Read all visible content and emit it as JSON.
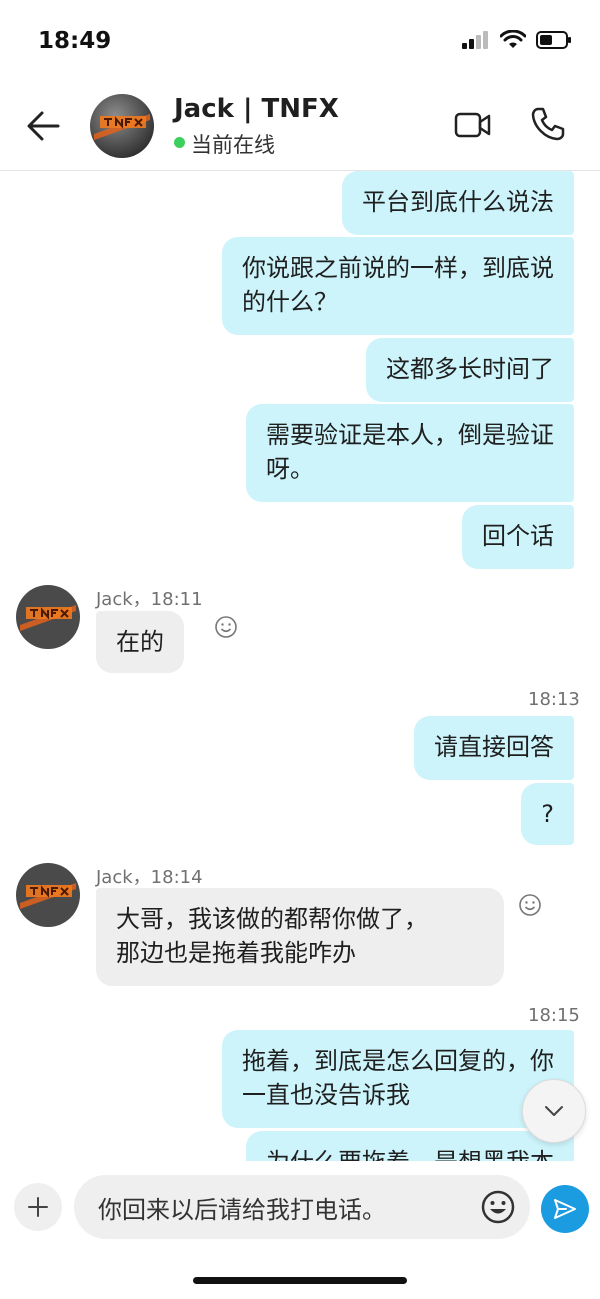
{
  "status_bar": {
    "time": "18:49"
  },
  "header": {
    "contact_name": "Jack | TNFX",
    "presence": "当前在线"
  },
  "messages": {
    "m1": "平台到底什么说法",
    "m2_line1": "你说跟之前说的一样，到底说",
    "m2_line2": "的什么？",
    "m3": "这都多长时间了",
    "m4_line1": "需要验证是本人，倒是验证",
    "m4_line2": "呀。",
    "m5": "回个话",
    "jack1_meta": "Jack，18:11",
    "jack1_text": "在的",
    "time_1813": "18:13",
    "m6": "请直接回答",
    "m7": "?",
    "jack2_meta": "Jack，18:14",
    "jack2_line1": "大哥，我该做的都帮你做了，",
    "jack2_line2": "那边也是拖着我能咋办",
    "time_1815": "18:15",
    "m8_line1": "拖着，到底是怎么回复的，你",
    "m8_line2": "一直也没告诉我",
    "m9_partial": "为什么要拖着，是想黑我本"
  },
  "composer": {
    "input_value": "你回来以后请给我打电话。"
  },
  "colors": {
    "outgoing_bubble": "#cdf4fb",
    "incoming_bubble": "#eeeeee",
    "online": "#3ccf5b",
    "send_button": "#1b9be0"
  },
  "icons": {
    "back": "arrow-left-icon",
    "video": "video-camera-icon",
    "call": "phone-icon",
    "react": "smiley-icon",
    "scroll": "chevron-down-icon",
    "plus": "plus-icon",
    "emoji": "emoji-icon",
    "send": "send-icon"
  }
}
